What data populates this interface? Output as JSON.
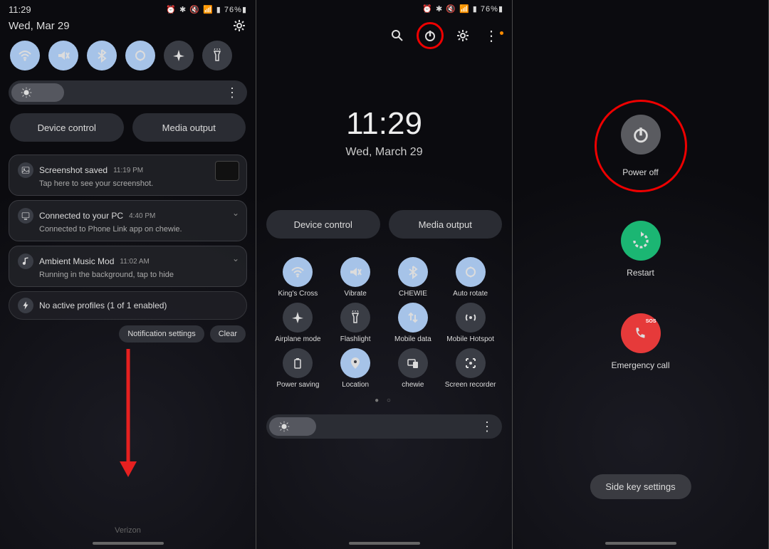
{
  "status": {
    "time": "11:29",
    "battery": "76%",
    "icons": "⏰ ✱ 🔇 📶 ▮"
  },
  "p1": {
    "date": "Wed, Mar 29",
    "quick": [
      {
        "name": "wifi",
        "on": true
      },
      {
        "name": "mute",
        "on": true
      },
      {
        "name": "bluetooth",
        "on": true
      },
      {
        "name": "rotate",
        "on": true
      },
      {
        "name": "airplane",
        "on": false
      },
      {
        "name": "flashlight",
        "on": false
      }
    ],
    "device_control": "Device control",
    "media_output": "Media output",
    "notifications": [
      {
        "icon": "image",
        "title": "Screenshot saved",
        "time": "11:19 PM",
        "body": "Tap here to see your screenshot.",
        "thumb": true
      },
      {
        "icon": "pc",
        "title": "Connected to your PC",
        "time": "4:40 PM",
        "body": "Connected to Phone Link app on chewie."
      },
      {
        "icon": "music",
        "title": "Ambient Music Mod",
        "time": "11:02 AM",
        "body": "Running in the background, tap to hide"
      }
    ],
    "slim": {
      "icon": "bolt",
      "text": "No active profiles (1 of 1 enabled)"
    },
    "action_settings": "Notification settings",
    "action_clear": "Clear",
    "carrier": "Verizon"
  },
  "p2": {
    "time": "11:29",
    "date": "Wed, March 29",
    "device_control": "Device control",
    "media_output": "Media output",
    "tiles": [
      {
        "label": "King's Cross",
        "icon": "wifi",
        "on": true
      },
      {
        "label": "Vibrate",
        "icon": "mute",
        "on": true
      },
      {
        "label": "CHEWIE",
        "icon": "bluetooth",
        "on": true
      },
      {
        "label": "Auto rotate",
        "icon": "rotate",
        "on": true
      },
      {
        "label": "Airplane mode",
        "icon": "airplane",
        "on": false
      },
      {
        "label": "Flashlight",
        "icon": "flashlight",
        "on": false
      },
      {
        "label": "Mobile data",
        "icon": "data",
        "on": true
      },
      {
        "label": "Mobile Hotspot",
        "icon": "hotspot",
        "on": false
      },
      {
        "label": "Power saving",
        "icon": "battery",
        "on": false
      },
      {
        "label": "Location",
        "icon": "location",
        "on": true
      },
      {
        "label": "chewie",
        "icon": "devices",
        "on": false
      },
      {
        "label": "Screen recorder",
        "icon": "record",
        "on": false
      }
    ]
  },
  "p3": {
    "power_off": "Power off",
    "restart": "Restart",
    "emergency": "Emergency call",
    "side_key": "Side key settings"
  }
}
